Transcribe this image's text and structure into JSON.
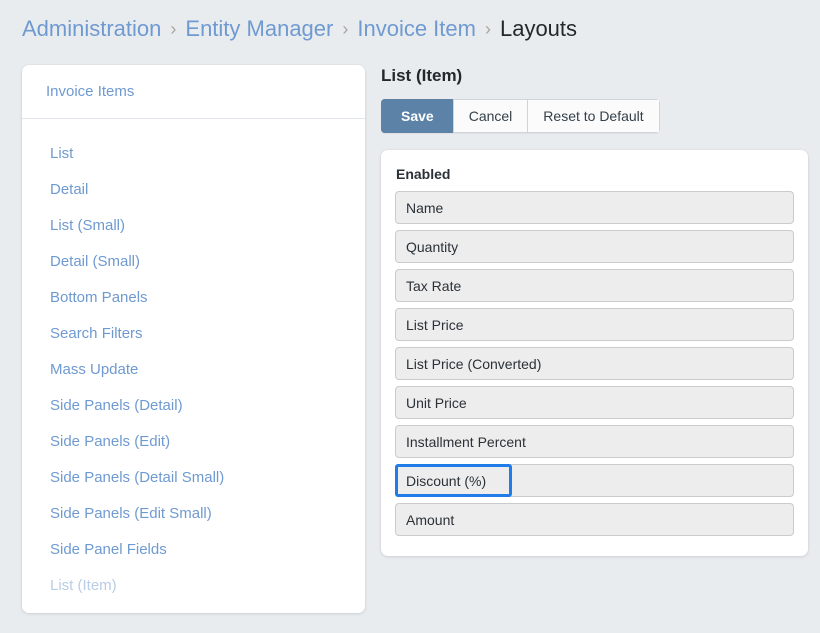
{
  "breadcrumb": {
    "separator": "›",
    "items": [
      {
        "label": "Administration",
        "current": false
      },
      {
        "label": "Entity Manager",
        "current": false
      },
      {
        "label": "Invoice Item",
        "current": false
      },
      {
        "label": "Layouts",
        "current": true
      }
    ]
  },
  "sidebar": {
    "header": "Invoice Items",
    "items": [
      {
        "label": "List",
        "active": false
      },
      {
        "label": "Detail",
        "active": false
      },
      {
        "label": "List (Small)",
        "active": false
      },
      {
        "label": "Detail (Small)",
        "active": false
      },
      {
        "label": "Bottom Panels",
        "active": false
      },
      {
        "label": "Search Filters",
        "active": false
      },
      {
        "label": "Mass Update",
        "active": false
      },
      {
        "label": "Side Panels (Detail)",
        "active": false
      },
      {
        "label": "Side Panels (Edit)",
        "active": false
      },
      {
        "label": "Side Panels (Detail Small)",
        "active": false
      },
      {
        "label": "Side Panels (Edit Small)",
        "active": false
      },
      {
        "label": "Side Panel Fields",
        "active": false
      },
      {
        "label": "List (Item)",
        "active": true
      }
    ]
  },
  "main": {
    "title": "List (Item)",
    "buttons": [
      {
        "label": "Save",
        "primary": true
      },
      {
        "label": "Cancel",
        "primary": false
      },
      {
        "label": "Reset to Default",
        "primary": false
      }
    ],
    "enabled_label": "Enabled",
    "fields": [
      {
        "label": "Name",
        "focused": false
      },
      {
        "label": "Quantity",
        "focused": false
      },
      {
        "label": "Tax Rate",
        "focused": false
      },
      {
        "label": "List Price",
        "focused": false
      },
      {
        "label": "List Price (Converted)",
        "focused": false
      },
      {
        "label": "Unit Price",
        "focused": false
      },
      {
        "label": "Installment Percent",
        "focused": false
      },
      {
        "label": "Discount (%)",
        "focused": true
      },
      {
        "label": "Amount",
        "focused": false
      }
    ]
  },
  "colors": {
    "page_background": "#e9ecef",
    "link_blue": "#6f9ad1",
    "link_blue_muted": "#b9cde6",
    "primary_button": "#5c82a8",
    "focus_ring": "#1f7ce8",
    "field_background": "#ededed",
    "field_border": "#cbcbcb",
    "text_dark": "#23282d"
  }
}
